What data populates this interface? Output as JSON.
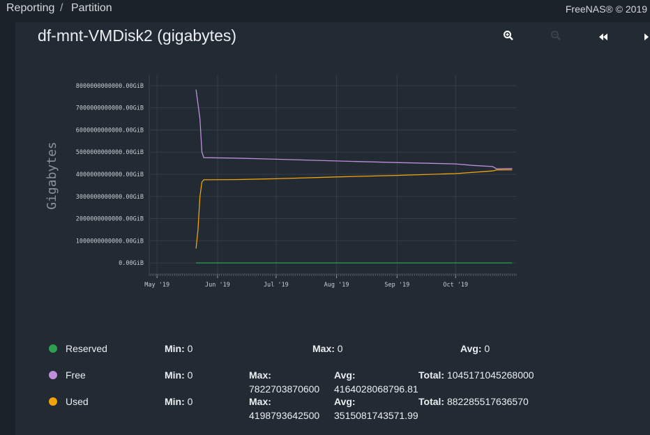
{
  "header": {
    "breadcrumb": [
      "Reporting",
      "Partition"
    ],
    "separator": "/",
    "copyright": "FreeNAS® © 2019"
  },
  "title": "df-mnt-VMDisk2 (gigabytes)",
  "controls": [
    "zoom-in-icon",
    "zoom-out-icon",
    "rewind-icon",
    "forward-icon"
  ],
  "chart_data": {
    "type": "line",
    "ylabel": "Gigabytes",
    "yticks": [
      "8000000000000.00GiB",
      "7000000000000.00GiB",
      "6000000000000.00GiB",
      "5000000000000.00GiB",
      "4000000000000.00GiB",
      "3000000000000.00GiB",
      "2000000000000.00GiB",
      "1000000000000.00GiB",
      "0.00GiB"
    ],
    "ytick_values": [
      8000000000000,
      7000000000000,
      6000000000000,
      5000000000000,
      4000000000000,
      3000000000000,
      2000000000000,
      1000000000000,
      0
    ],
    "xticks": [
      "May '19",
      "Jun '19",
      "Jul '19",
      "Aug '19",
      "Sep '19",
      "Oct '19"
    ],
    "xtick_dates": [
      "2019-05-01",
      "2019-06-01",
      "2019-07-01",
      "2019-08-01",
      "2019-09-01",
      "2019-10-01"
    ],
    "x_range": [
      "2019-04-27",
      "2019-11-01"
    ],
    "y_range": [
      -500000000000,
      8500000000000
    ],
    "grid": true,
    "series": [
      {
        "name": "Reserved",
        "color": "#2e9e4f",
        "points": [
          [
            "2019-05-21",
            0
          ],
          [
            "2019-10-30",
            0
          ]
        ]
      },
      {
        "name": "Free",
        "color": "#c08fdb",
        "points": [
          [
            "2019-05-21",
            7822703870600
          ],
          [
            "2019-05-23",
            6500000000000
          ],
          [
            "2019-05-24",
            5000000000000
          ],
          [
            "2019-05-25",
            4750000000000
          ],
          [
            "2019-06-10",
            4730000000000
          ],
          [
            "2019-07-01",
            4680000000000
          ],
          [
            "2019-08-01",
            4600000000000
          ],
          [
            "2019-09-01",
            4530000000000
          ],
          [
            "2019-10-01",
            4470000000000
          ],
          [
            "2019-10-10",
            4400000000000
          ],
          [
            "2019-10-20",
            4350000000000
          ],
          [
            "2019-10-22",
            4250000000000
          ],
          [
            "2019-10-30",
            4260000000000
          ]
        ]
      },
      {
        "name": "Used",
        "color": "#f0a30a",
        "points": [
          [
            "2019-05-21",
            650000000000
          ],
          [
            "2019-05-22",
            1500000000000
          ],
          [
            "2019-05-23",
            3000000000000
          ],
          [
            "2019-05-24",
            3650000000000
          ],
          [
            "2019-05-25",
            3750000000000
          ],
          [
            "2019-06-10",
            3760000000000
          ],
          [
            "2019-07-01",
            3800000000000
          ],
          [
            "2019-08-01",
            3880000000000
          ],
          [
            "2019-09-01",
            3950000000000
          ],
          [
            "2019-10-01",
            4030000000000
          ],
          [
            "2019-10-20",
            4150000000000
          ],
          [
            "2019-10-22",
            4198793642500
          ],
          [
            "2019-10-30",
            4200000000000
          ]
        ]
      }
    ]
  },
  "legend": [
    {
      "name": "Reserved",
      "color": "#2e9e4f",
      "min_label": "Min:",
      "min": "0",
      "max_label": "Max:",
      "max": "0",
      "avg_label": "Avg:",
      "avg": "0"
    },
    {
      "name": "Free",
      "color": "#c08fdb",
      "min_label": "Min:",
      "min": "0",
      "max_label": "Max:",
      "max": "7822703870600",
      "avg_label": "Avg:",
      "avg": "4164028068796.81",
      "total_label": "Total:",
      "total": "1045171045268000"
    },
    {
      "name": "Used",
      "color": "#f0a30a",
      "min_label": "Min:",
      "min": "0",
      "max_label": "Max:",
      "max": "4198793642500",
      "avg_label": "Avg:",
      "avg": "3515081743571.99",
      "total_label": "Total:",
      "total": "882285517636570"
    }
  ]
}
